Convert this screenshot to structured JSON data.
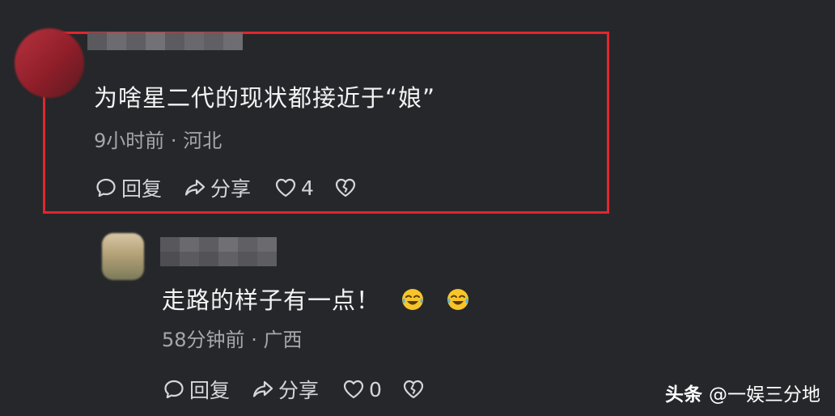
{
  "comments": [
    {
      "text": "为啥星二代的现状都接近于“娘”",
      "time": "9小时前",
      "separator": "·",
      "location": "河北",
      "reply_label": "回复",
      "share_label": "分享",
      "like_count": "4",
      "highlighted": true,
      "highlight_color": "#e3262b"
    },
    {
      "text": "走路的样子有一点！",
      "emojis": [
        "laughing-tears-emoji",
        "laughing-tears-emoji"
      ],
      "time": "58分钟前",
      "separator": "·",
      "location": "广西",
      "reply_label": "回复",
      "share_label": "分享",
      "like_count": "0",
      "highlighted": false
    }
  ],
  "watermark": {
    "brand": "头条",
    "handle": "@一娱三分地"
  },
  "colors": {
    "background": "#26272b",
    "text": "#f4f4f4",
    "meta": "#a7a7ab",
    "highlight": "#e3262b"
  },
  "icons": [
    "comment-bubble-icon",
    "share-arrow-icon",
    "heart-icon",
    "broken-heart-icon"
  ]
}
